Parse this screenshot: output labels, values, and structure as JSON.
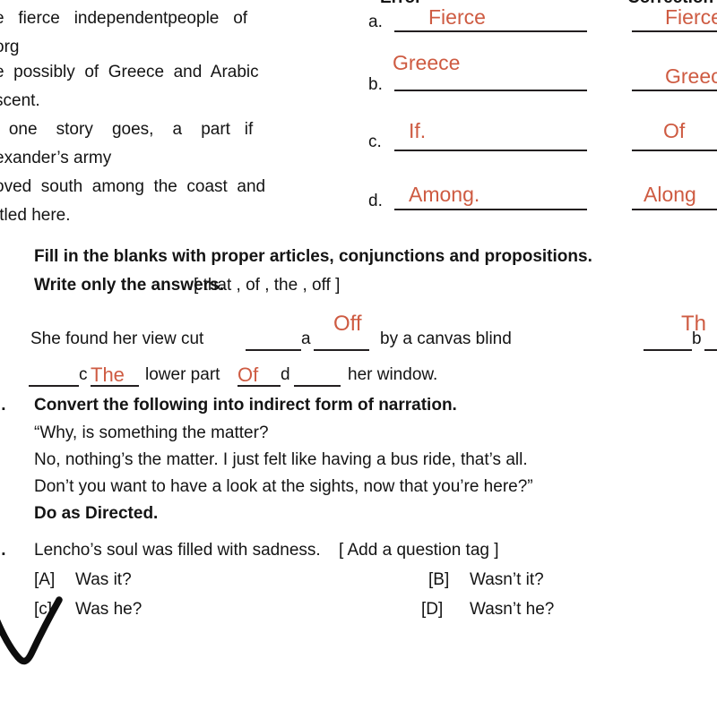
{
  "document": {
    "type": "english-exam-worksheet",
    "ink_color": "#CE5B42",
    "text_color": "#141414"
  },
  "passage": {
    "lines": [
      "e   fierce   independentpeople   of",
      "org",
      "e  possibly  of  Greece  and  Arabic",
      "scent.",
      "   one    story    goes,    a    part   if",
      "exander’s army",
      "oved  south  among  the  coast  and",
      "ttled here."
    ]
  },
  "error_correction": {
    "headers": {
      "error": "Error",
      "correction": "Correction"
    },
    "rows": [
      {
        "label": "a.",
        "error": "Fierce",
        "correction": "Fierce"
      },
      {
        "label": "b.",
        "error": "Greece",
        "correction": "Greece"
      },
      {
        "label": "c.",
        "error": "If.",
        "correction": "Of"
      },
      {
        "label": "d.",
        "error": "Among.",
        "correction": "Along"
      }
    ]
  },
  "q_fill_blanks": {
    "number": ".",
    "instruction_line1": "Fill in the blanks with proper articles, conjunctions and propositions.",
    "instruction_line2_bold": "Write only the answers.",
    "word_bank": "[ that , of , the , off ]",
    "sentence_part1": "She  found  her  view  cut",
    "sentence_part2": "by  a  canvas  blind",
    "sentence_part3": "lower part",
    "sentence_part4": "her window.",
    "blank_a_mark": "a",
    "blank_b_mark": "b",
    "blank_c_mark": "c",
    "blank_d_mark": "d",
    "answer_a": "Off",
    "answer_b": "Th",
    "answer_c": "The",
    "answer_d": "Of"
  },
  "q_narration": {
    "number": "..",
    "instruction": "Convert the following into indirect form of narration.",
    "lines": [
      "“Why, is something the matter?",
      "No, nothing’s the matter. I just felt like having a bus ride, that’s all.",
      "Don’t you want to have a look at the sights, now that you’re here?”"
    ]
  },
  "q_directed": {
    "heading": "Do as Directed.",
    "number": "..",
    "stem": "Lencho’s soul was filled with sadness.",
    "directive": "[ Add a question tag ]",
    "options": [
      {
        "key": "[A]",
        "text": "Was it?"
      },
      {
        "key": "[B]",
        "text": "Wasn’t it?"
      },
      {
        "key": "[c]",
        "text": "Was he?"
      },
      {
        "key": "[D]",
        "text": "Wasn’t he?"
      }
    ],
    "selected_option_key": "[c]",
    "tick_mark": "handwritten-check"
  }
}
